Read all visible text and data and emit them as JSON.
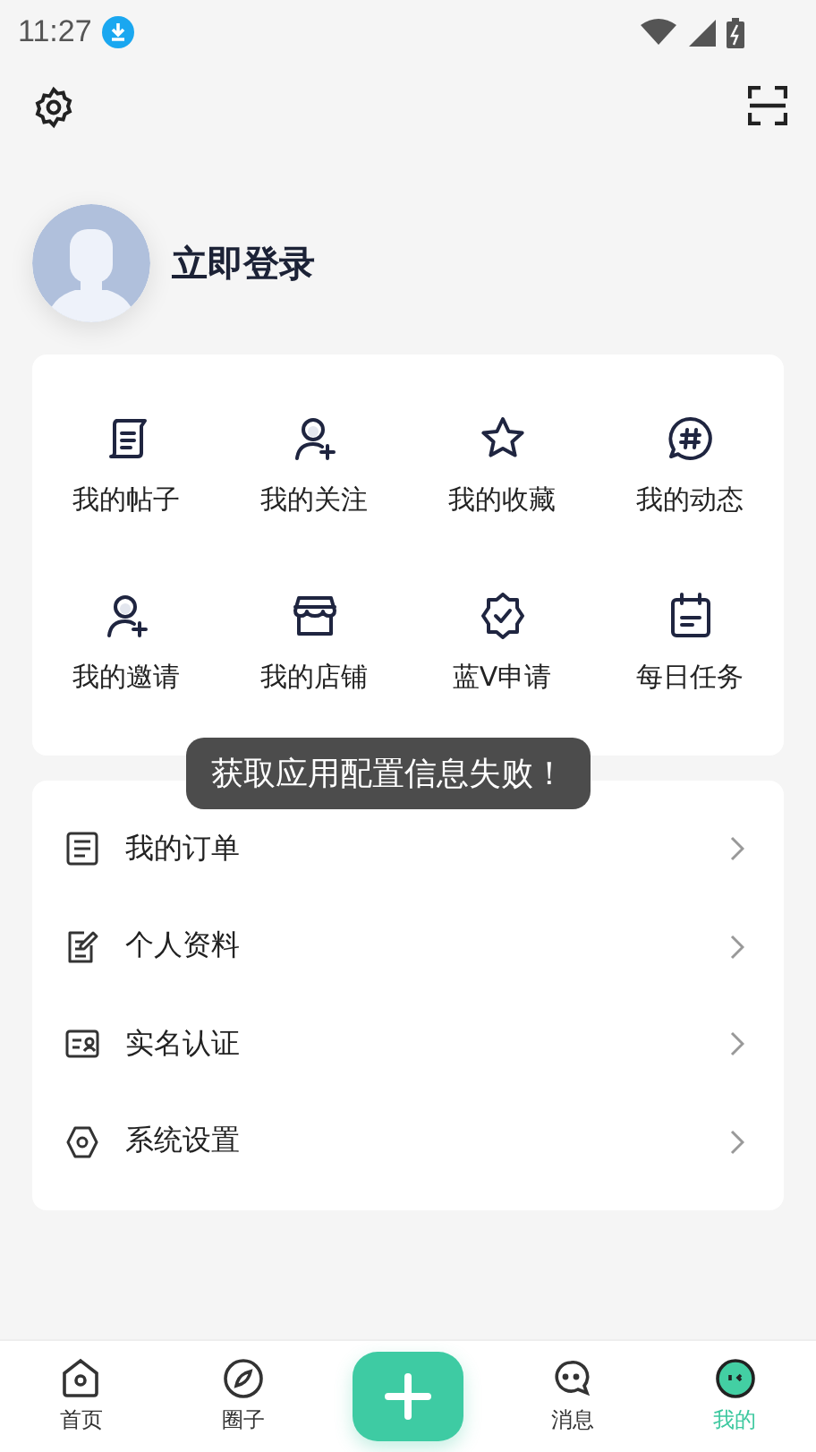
{
  "status_bar": {
    "time": "11:27"
  },
  "profile": {
    "login_label": "立即登录"
  },
  "shortcuts": [
    {
      "kind": "post",
      "label": "我的帖子"
    },
    {
      "kind": "follow",
      "label": "我的关注"
    },
    {
      "kind": "star",
      "label": "我的收藏"
    },
    {
      "kind": "topic",
      "label": "我的动态"
    },
    {
      "kind": "invite",
      "label": "我的邀请"
    },
    {
      "kind": "shop",
      "label": "我的店铺"
    },
    {
      "kind": "badge",
      "label": "蓝V申请"
    },
    {
      "kind": "calendar",
      "label": "每日任务"
    }
  ],
  "menu": [
    {
      "kind": "order",
      "label": "我的订单"
    },
    {
      "kind": "profile",
      "label": "个人资料"
    },
    {
      "kind": "idcard",
      "label": "实名认证"
    },
    {
      "kind": "settings",
      "label": "系统设置"
    }
  ],
  "toast": "获取应用配置信息失败！",
  "tabs": [
    {
      "kind": "home",
      "label": "首页",
      "selected": false
    },
    {
      "kind": "compass",
      "label": "圈子",
      "selected": false
    },
    {
      "kind": "add"
    },
    {
      "kind": "message",
      "label": "消息",
      "selected": false
    },
    {
      "kind": "me",
      "label": "我的",
      "selected": true
    }
  ]
}
